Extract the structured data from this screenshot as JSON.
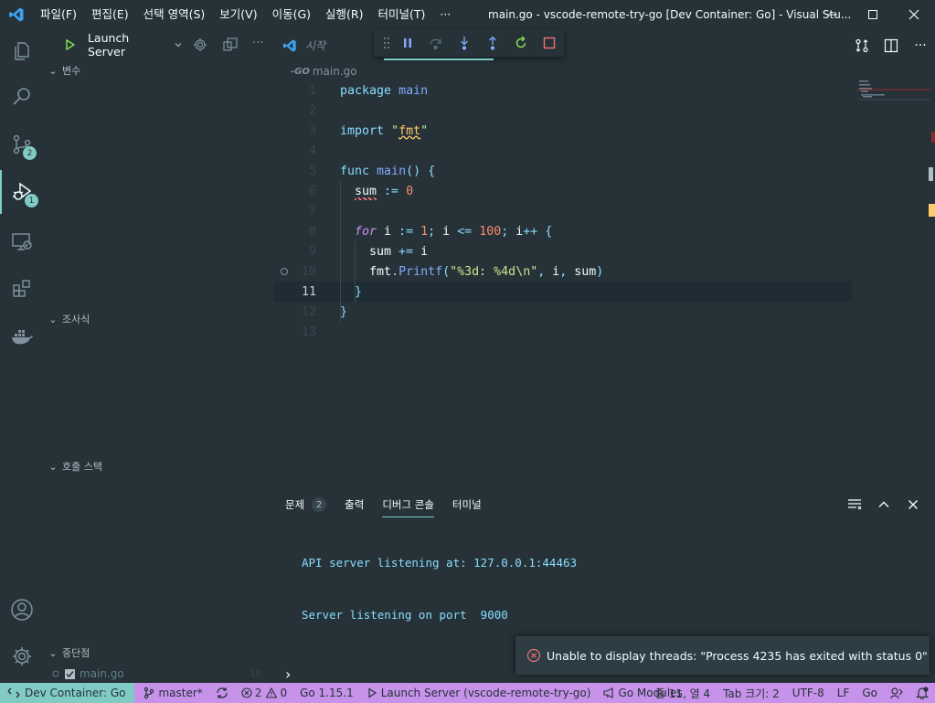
{
  "window": {
    "title": "main.go - vscode-remote-try-go [Dev Container: Go] - Visual Stu..."
  },
  "menu": [
    "파일(F)",
    "편집(E)",
    "선택 영역(S)",
    "보기(V)",
    "이동(G)",
    "실행(R)",
    "터미널(T)",
    "···"
  ],
  "activity_bar": {
    "scm_badge": "2",
    "debug_badge": "1"
  },
  "sidebar": {
    "launch_config": "Launch Server",
    "sections": {
      "variables": "변수",
      "watch": "조사식",
      "call_stack": "호출 스택",
      "breakpoints": "중단점"
    },
    "breakpoint_item": {
      "file": "main.go",
      "line": "10",
      "checked": true
    }
  },
  "editor": {
    "start_tab": "시작",
    "breadcrumb": "main.go",
    "current_line": 11,
    "code_lines": [
      "package main",
      "",
      "import \"fmt\"",
      "",
      "func main() {",
      "  sum := 0",
      "",
      "  for i := 1; i <= 100; i++ {",
      "    sum += i",
      "    fmt.Printf(\"%3d: %4d\\n\", i, sum)",
      "  }",
      "}",
      ""
    ]
  },
  "panel": {
    "tabs": [
      {
        "label": "문제",
        "count": "2"
      },
      {
        "label": "출력"
      },
      {
        "label": "디버그 콘솔",
        "active": true
      },
      {
        "label": "터미널"
      }
    ],
    "console_lines": [
      "API server listening at: 127.0.0.1:44463",
      "Server listening on port  9000"
    ],
    "repl_prompt": "›"
  },
  "notification": {
    "message": "Unable to display threads: \"Process 4235 has exited with status 0\""
  },
  "statusbar": {
    "remote": "Dev Container: Go",
    "branch": "master*",
    "errors": "2",
    "warnings": "0",
    "go_version": "Go 1.15.1",
    "debug_session": "Launch Server (vscode-remote-try-go)",
    "go_modules": "Go Modules",
    "position": "줄 11, 열 4",
    "indent": "Tab 크기: 2",
    "encoding": "UTF-8",
    "eol": "LF",
    "language": "Go"
  },
  "colors": {
    "background": "#263238",
    "accent": "#80cbc4",
    "statusbar": "#c792ea",
    "error": "#f07178"
  }
}
